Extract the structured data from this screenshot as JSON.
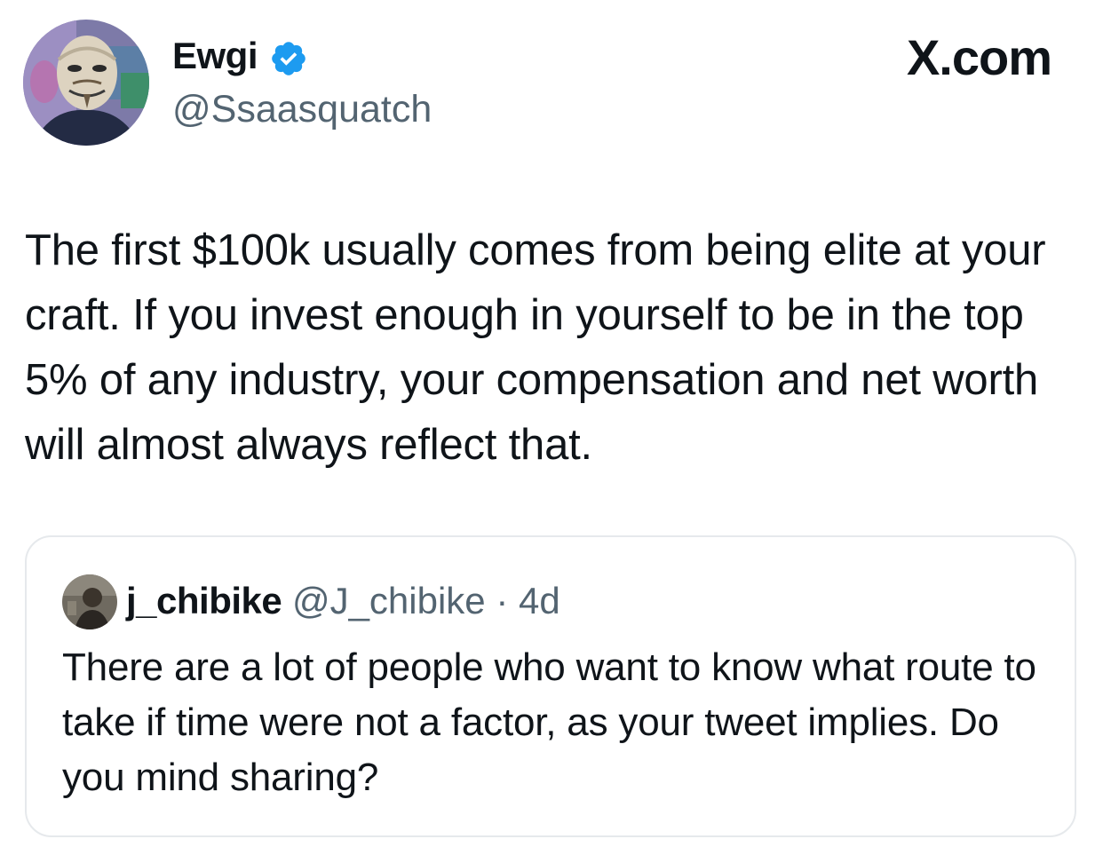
{
  "tweet": {
    "author": {
      "display_name": "Ewgi",
      "handle": "@Ssaasquatch",
      "verified": true,
      "avatar_icon": "masked-avatar-icon"
    },
    "brand": "X.com",
    "text": "The first $100k usually comes from being elite at your craft. If you invest enough in yourself to be in the top 5% of any industry, your compensation and net worth will almost always reflect that."
  },
  "quoted_tweet": {
    "author": {
      "display_name": "j_chibike",
      "handle": "@J_chibike",
      "avatar_icon": "user-photo-avatar-icon"
    },
    "separator": " · ",
    "time": "4d",
    "text": "There are a lot of people who want to know what route to take if time were not a factor, as your tweet implies. Do you mind sharing?"
  },
  "colors": {
    "text_primary": "#0f1419",
    "text_secondary": "#536471",
    "verified_blue": "#1d9bf0",
    "card_border": "#e6e9ec",
    "background": "#ffffff"
  }
}
